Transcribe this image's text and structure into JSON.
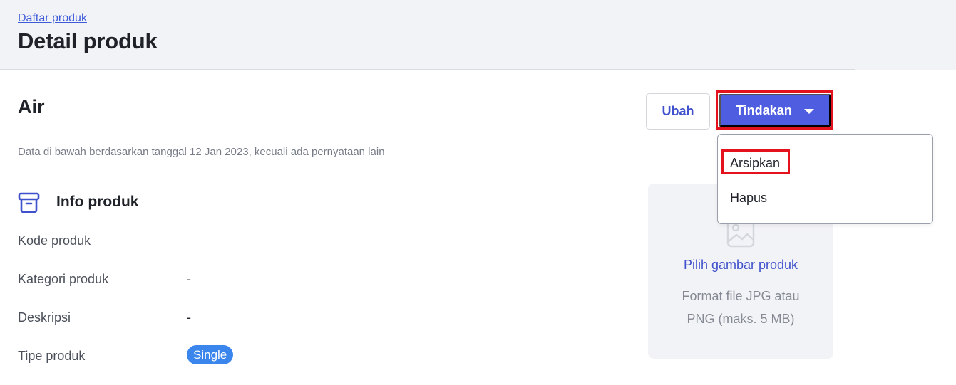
{
  "header": {
    "breadcrumb": "Daftar produk",
    "title": "Detail produk"
  },
  "product": {
    "name": "Air",
    "data_note": "Data di bawah berdasarkan tanggal 12 Jan 2023, kecuali ada pernyataan lain"
  },
  "toolbar": {
    "edit_label": "Ubah",
    "actions_label": "Tindakan",
    "actions_icon": "chevron-down-icon"
  },
  "actions_menu": {
    "items": [
      {
        "label": "Arsipkan"
      },
      {
        "label": "Hapus"
      }
    ]
  },
  "info_section": {
    "icon": "archive-box-icon",
    "title": "Info produk",
    "rows": [
      {
        "label": "Kode produk",
        "value": ""
      },
      {
        "label": "Kategori produk",
        "value": "-"
      },
      {
        "label": "Deskripsi",
        "value": "-"
      },
      {
        "label": "Tipe produk",
        "value": "Single"
      }
    ]
  },
  "image_upload": {
    "icon": "image-icon",
    "pick_label": "Pilih gambar produk",
    "hint": "Format file JPG atau PNG (maks. 5 MB)"
  },
  "colors": {
    "primary": "#4f5de0",
    "link": "#3d5bd9",
    "badge": "#3b86ec",
    "highlight": "#e3121d",
    "header_bg": "#f2f3f6"
  }
}
